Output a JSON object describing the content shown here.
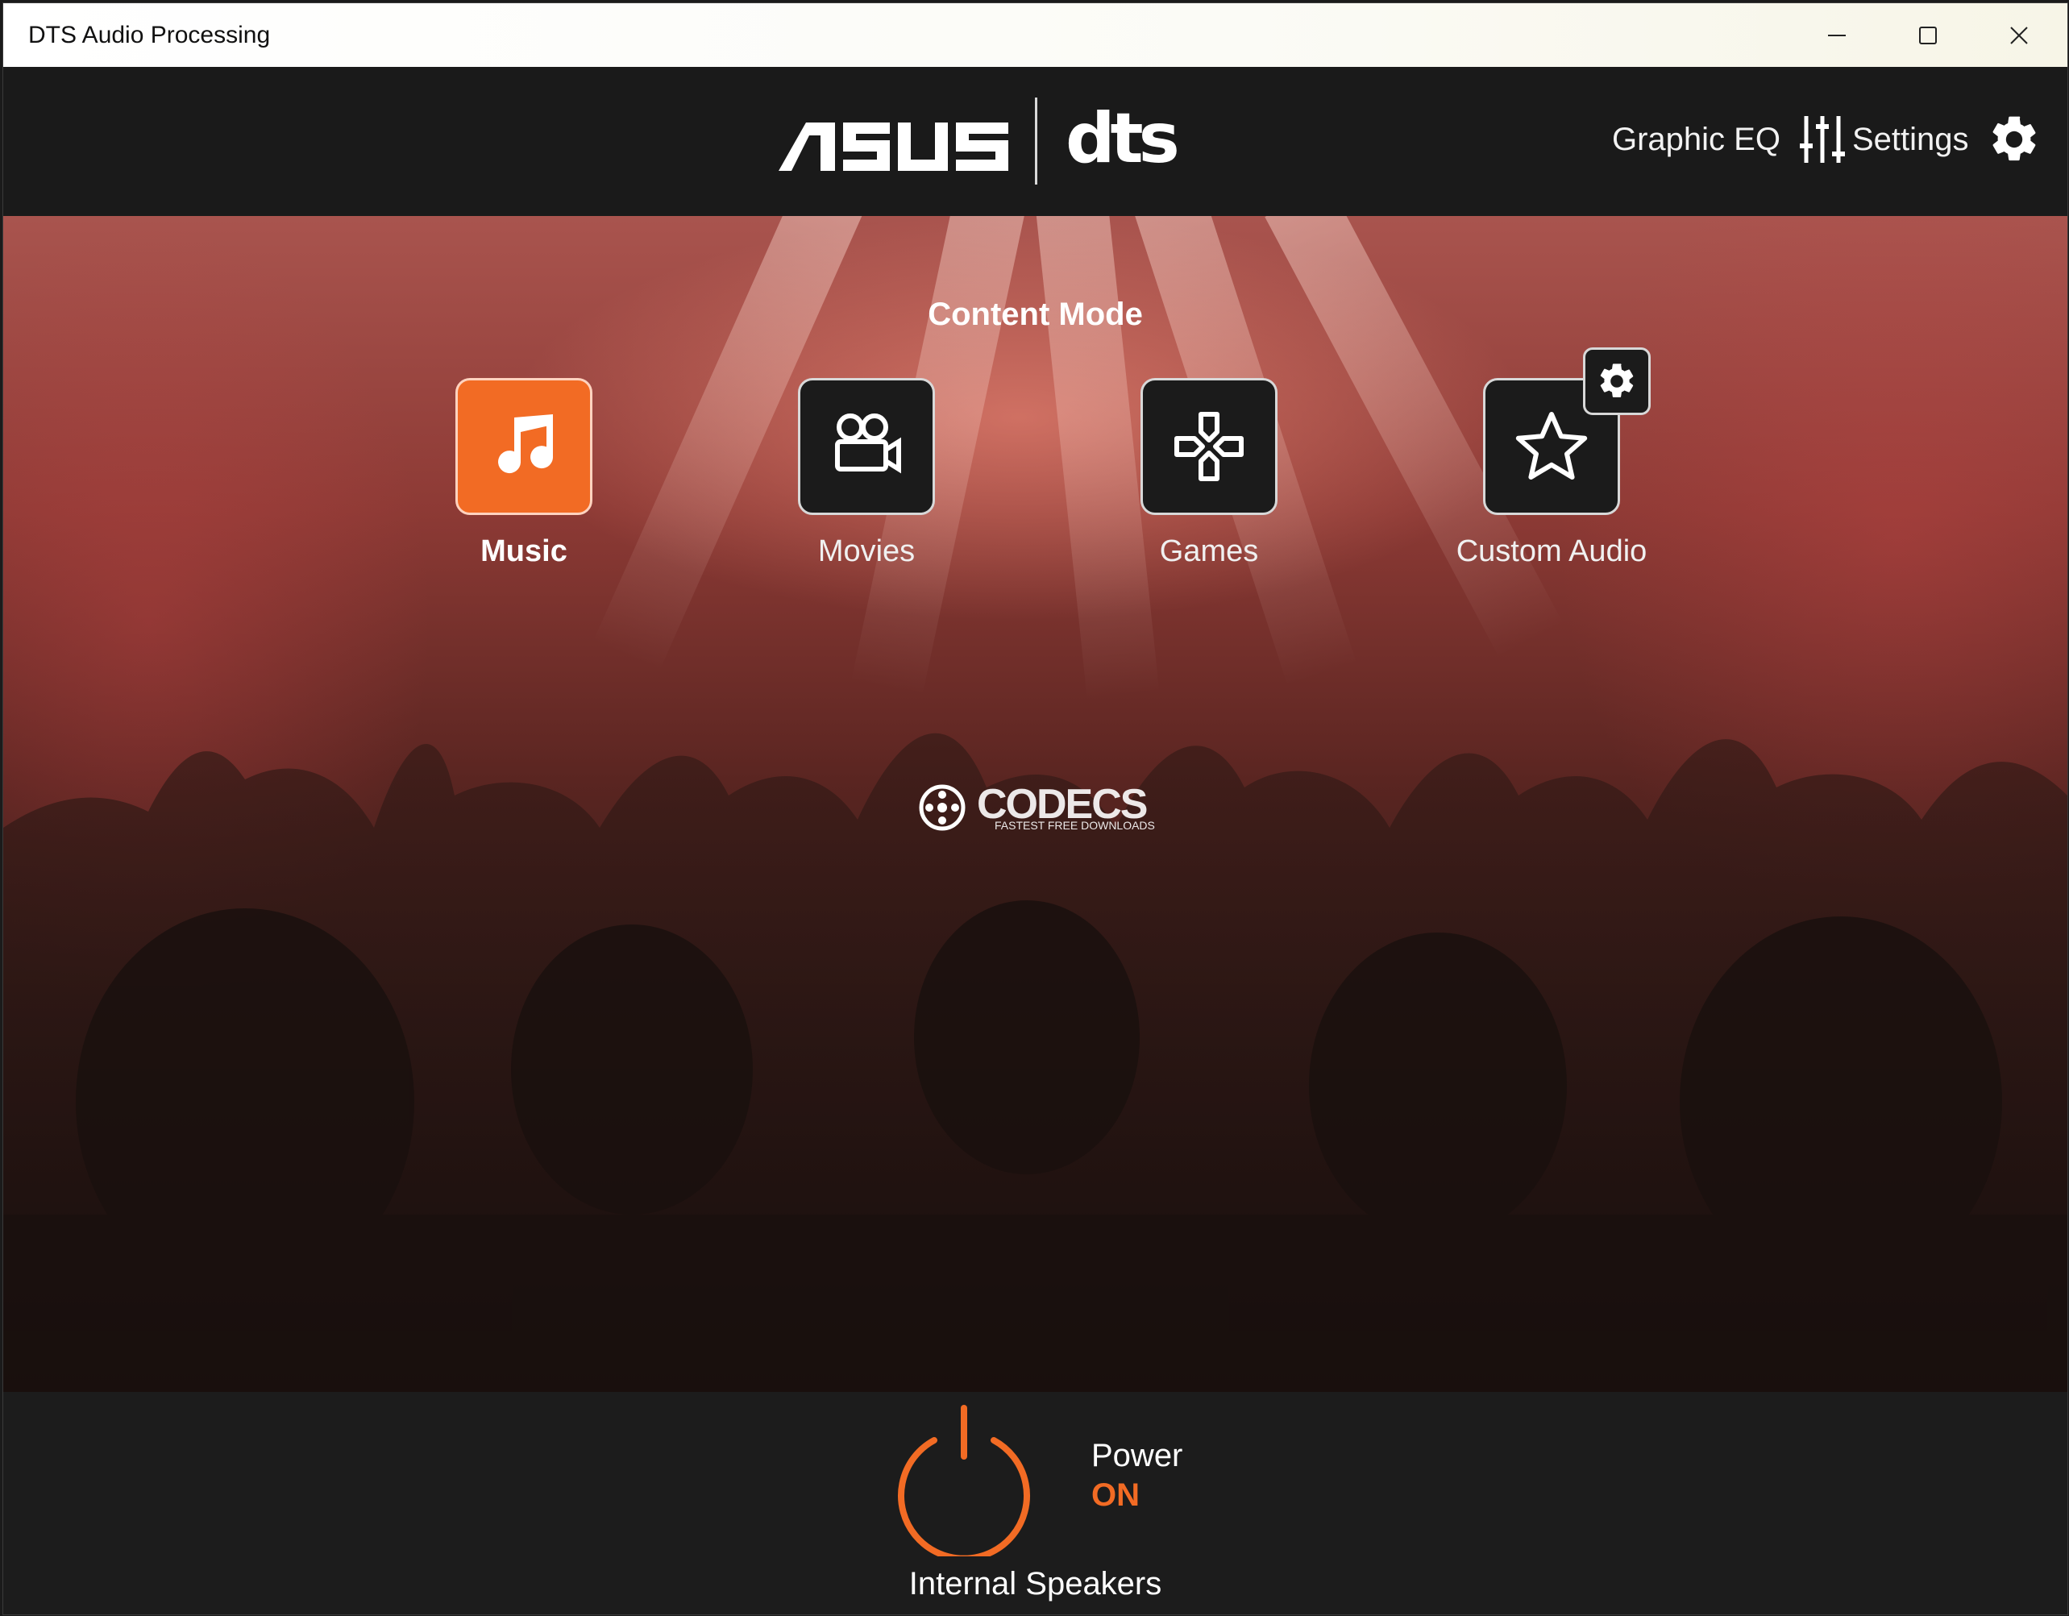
{
  "window": {
    "title": "DTS Audio Processing"
  },
  "header": {
    "brand_primary": "ASUS",
    "brand_secondary": "dts",
    "graphic_eq_label": "Graphic EQ",
    "graphic_eq_icon": "sliders-icon",
    "settings_label": "Settings",
    "settings_icon": "gear-icon"
  },
  "content_mode": {
    "title": "Content Mode",
    "selected": "Music",
    "modes": [
      {
        "label": "Music",
        "icon": "music-note-icon",
        "active": true
      },
      {
        "label": "Movies",
        "icon": "movie-camera-icon",
        "active": false
      },
      {
        "label": "Games",
        "icon": "dpad-icon",
        "active": false
      },
      {
        "label": "Custom Audio",
        "icon": "star-icon",
        "active": false
      }
    ],
    "custom_settings_icon": "gear-icon"
  },
  "watermark": {
    "main": "CODECS",
    "sub": "FASTEST FREE DOWNLOADS"
  },
  "footer": {
    "power_label": "Power",
    "power_state": "ON",
    "output_device": "Internal Speakers"
  },
  "colors": {
    "accent": "#f26b24",
    "header_bg": "#1a1a1a",
    "tile_bg": "#1b1b1b"
  }
}
